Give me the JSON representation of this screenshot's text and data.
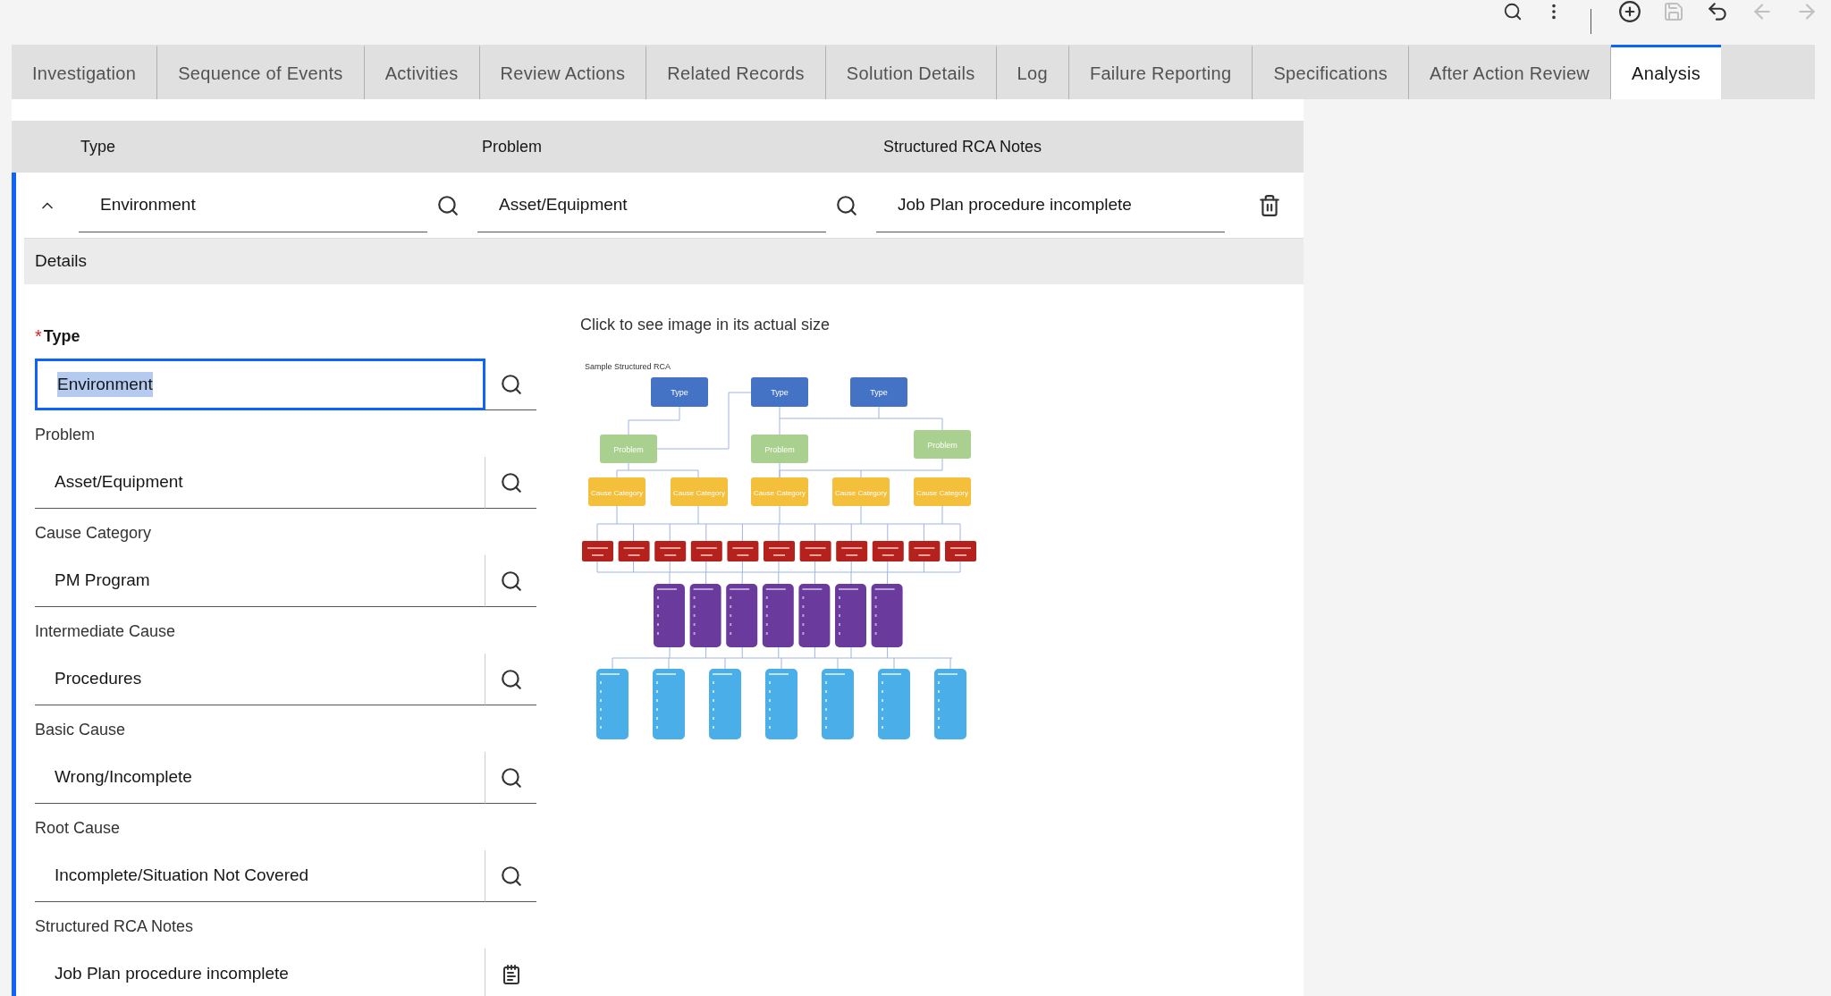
{
  "tabs": [
    {
      "label": "Investigation",
      "selected": false
    },
    {
      "label": "Sequence of Events",
      "selected": false
    },
    {
      "label": "Activities",
      "selected": false
    },
    {
      "label": "Review Actions",
      "selected": false
    },
    {
      "label": "Related Records",
      "selected": false
    },
    {
      "label": "Solution Details",
      "selected": false
    },
    {
      "label": "Log",
      "selected": false
    },
    {
      "label": "Failure Reporting",
      "selected": false
    },
    {
      "label": "Specifications",
      "selected": false
    },
    {
      "label": "After Action Review",
      "selected": false
    },
    {
      "label": "Analysis",
      "selected": true
    }
  ],
  "table": {
    "columns": [
      "Type",
      "Problem",
      "Structured RCA Notes"
    ],
    "row": {
      "expanded": true,
      "type": "Environment",
      "problem": "Asset/Equipment",
      "notes": "Job Plan procedure incomplete"
    }
  },
  "details": {
    "title": "Details",
    "required_marker": "*",
    "fields": [
      {
        "label": "Type",
        "required": true,
        "value": "Environment",
        "focused": true,
        "kind": "lookup"
      },
      {
        "label": "Problem",
        "required": false,
        "value": "Asset/Equipment",
        "focused": false,
        "kind": "lookup"
      },
      {
        "label": "Cause Category",
        "required": false,
        "value": "PM Program",
        "focused": false,
        "kind": "lookup"
      },
      {
        "label": "Intermediate Cause",
        "required": false,
        "value": "Procedures",
        "focused": false,
        "kind": "lookup"
      },
      {
        "label": "Basic Cause",
        "required": false,
        "value": "Wrong/Incomplete",
        "focused": false,
        "kind": "lookup"
      },
      {
        "label": "Root Cause",
        "required": false,
        "value": "Incomplete/Situation Not Covered",
        "focused": false,
        "kind": "lookup"
      },
      {
        "label": "Structured RCA Notes",
        "required": false,
        "value": "Job Plan procedure incomplete",
        "focused": false,
        "kind": "longtext"
      }
    ],
    "image_hint": "Click to see image in its actual size",
    "diagram": {
      "title": "Sample Structured RCA",
      "types": [
        "Type",
        "Type",
        "Type"
      ],
      "problems": [
        "Problem",
        "Problem",
        "Problem"
      ],
      "cause_categories": [
        "Cause Category",
        "Cause Category",
        "Cause Category",
        "Cause Category",
        "Cause Category"
      ],
      "intermediate_causes": [
        {
          "kind": "box"
        },
        {
          "kind": "box"
        },
        {
          "kind": "box"
        },
        {
          "kind": "box"
        },
        {
          "kind": "box"
        },
        {
          "kind": "box"
        },
        {
          "kind": "box"
        },
        {
          "kind": "box"
        },
        {
          "kind": "box"
        },
        {
          "kind": "box"
        },
        {
          "kind": "box"
        }
      ],
      "basic_causes": [
        {
          "kind": "box"
        },
        {
          "kind": "box"
        },
        {
          "kind": "box"
        },
        {
          "kind": "box"
        },
        {
          "kind": "box"
        },
        {
          "kind": "box"
        },
        {
          "kind": "box"
        }
      ],
      "root_causes": [
        {
          "kind": "box"
        },
        {
          "kind": "box"
        },
        {
          "kind": "box"
        },
        {
          "kind": "box"
        },
        {
          "kind": "box"
        },
        {
          "kind": "box"
        },
        {
          "kind": "box"
        }
      ]
    }
  }
}
